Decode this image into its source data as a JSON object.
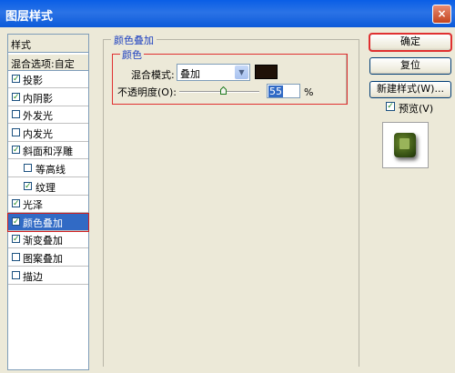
{
  "window": {
    "title": "图层样式",
    "close_glyph": "×"
  },
  "style_list": {
    "header": "样式",
    "blend_options": "混合选项:自定",
    "items": [
      {
        "label": "投影",
        "checked": true,
        "indent": false
      },
      {
        "label": "内阴影",
        "checked": true,
        "indent": false
      },
      {
        "label": "外发光",
        "checked": false,
        "indent": false
      },
      {
        "label": "内发光",
        "checked": false,
        "indent": false
      },
      {
        "label": "斜面和浮雕",
        "checked": true,
        "indent": false
      },
      {
        "label": "等高线",
        "checked": false,
        "indent": true
      },
      {
        "label": "纹理",
        "checked": true,
        "indent": true
      },
      {
        "label": "光泽",
        "checked": true,
        "indent": false
      },
      {
        "label": "颜色叠加",
        "checked": true,
        "indent": false,
        "active": true
      },
      {
        "label": "渐变叠加",
        "checked": true,
        "indent": false
      },
      {
        "label": "图案叠加",
        "checked": false,
        "indent": false
      },
      {
        "label": "描边",
        "checked": false,
        "indent": false
      }
    ]
  },
  "panel": {
    "title": "颜色叠加",
    "group_title": "颜色",
    "blend_mode_label": "混合模式:",
    "blend_mode_value": "叠加",
    "color_swatch": "#1f1107",
    "opacity_label": "不透明度(O):",
    "opacity_value": "55",
    "opacity_unit": "%",
    "opacity_fraction": 0.55
  },
  "buttons": {
    "ok": "确定",
    "reset": "复位",
    "new_style": "新建样式(W)...",
    "preview_label": "预览(V)",
    "preview_checked": true
  },
  "colors": {
    "titlebar": "#0a5ee6",
    "selection": "#316ac5",
    "highlight_border": "#e03030",
    "group_title": "#1c3fc0"
  }
}
